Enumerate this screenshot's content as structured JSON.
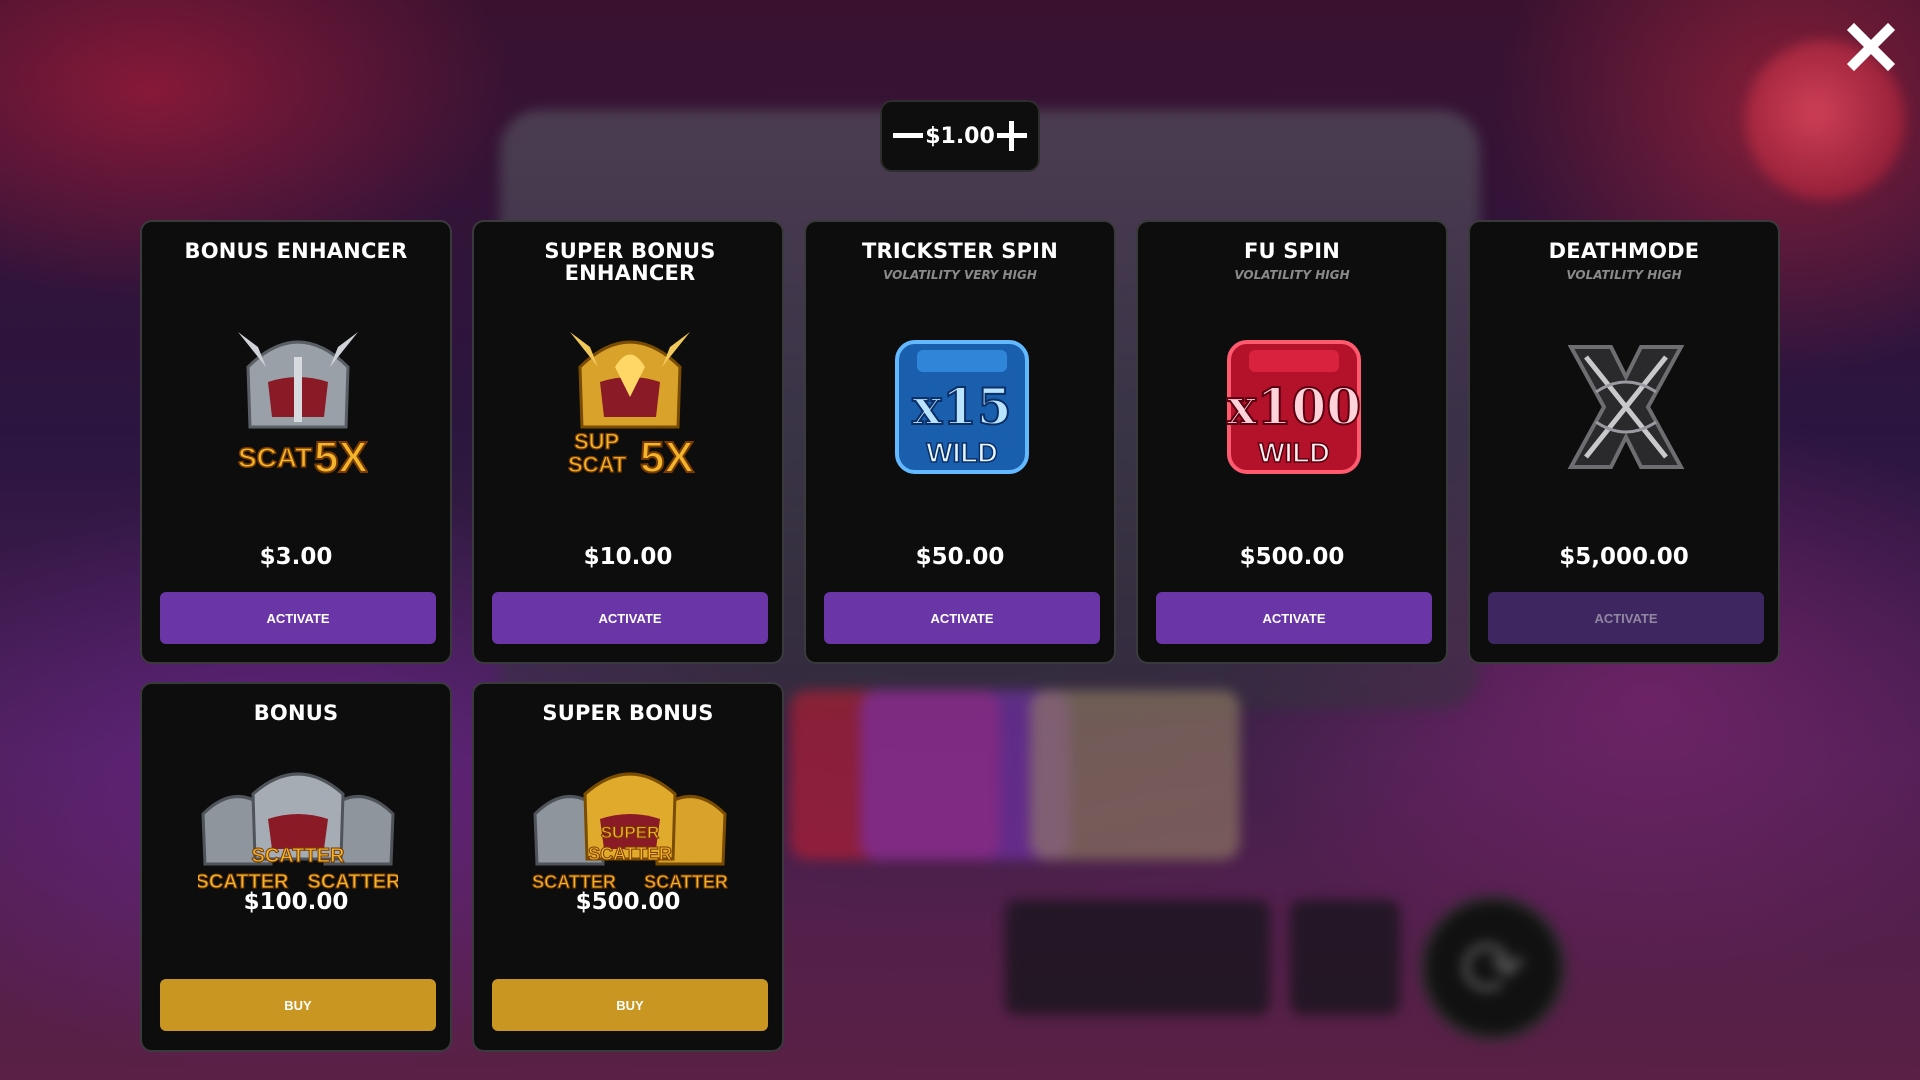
{
  "colors": {
    "activate": "#6a35a6",
    "activate_disabled": "#3e2660",
    "buy": "#c99621",
    "card_bg": "#0d0d0e"
  },
  "close_icon": "close-x-icon",
  "bet": {
    "value": "$1.00",
    "decrease_icon": "minus-icon",
    "increase_icon": "plus-icon"
  },
  "features": [
    {
      "title": "BONUS ENHANCER",
      "subtitle": "",
      "icon": "scatter-5x-helmet-icon",
      "price": "$3.00",
      "button": "ACTIVATE",
      "enabled": true
    },
    {
      "title": "SUPER BONUS ENHANCER",
      "subtitle": "",
      "icon": "super-scatter-5x-helmet-icon",
      "price": "$10.00",
      "button": "ACTIVATE",
      "enabled": true
    },
    {
      "title": "TRICKSTER SPIN",
      "subtitle": "VOLATILITY VERY HIGH",
      "icon": "x15-wild-icon",
      "price": "$50.00",
      "button": "ACTIVATE",
      "enabled": true
    },
    {
      "title": "FU SPIN",
      "subtitle": "VOLATILITY HIGH",
      "icon": "x100-wild-icon",
      "price": "$500.00",
      "button": "ACTIVATE",
      "enabled": true
    },
    {
      "title": "DEATHMODE",
      "subtitle": "VOLATILITY HIGH",
      "icon": "celtic-knot-x-icon",
      "price": "$5,000.00",
      "button": "ACTIVATE",
      "enabled": false
    }
  ],
  "buys": [
    {
      "title": "BONUS",
      "icon": "triple-scatter-helmet-icon",
      "price": "$100.00",
      "button": "BUY"
    },
    {
      "title": "SUPER BONUS",
      "icon": "triple-super-scatter-helmet-icon",
      "price": "$500.00",
      "button": "BUY"
    }
  ],
  "art_text": {
    "scat": "SCAT",
    "sup": "SUP",
    "five_x": "5X",
    "x15": "x15",
    "x100": "x100",
    "wild": "WILD",
    "scatter": "SCATTER",
    "super": "SUPER"
  }
}
